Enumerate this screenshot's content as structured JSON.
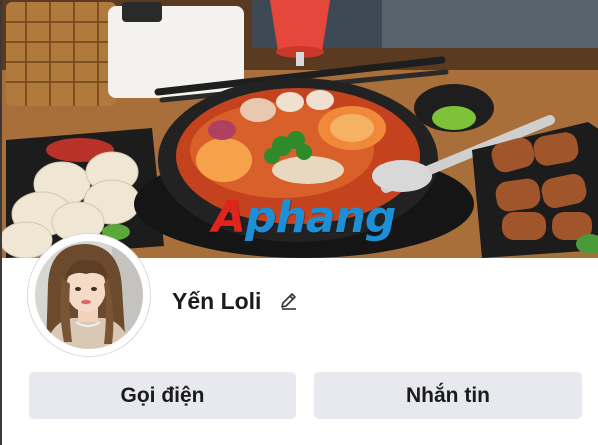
{
  "profile": {
    "display_name": "Yến Loli"
  },
  "actions": {
    "call_label": "Gọi điện",
    "message_label": "Nhắn tin"
  },
  "cover": {
    "watermark_first": "A",
    "watermark_rest": "phang"
  },
  "icons": {
    "edit": "pencil-icon"
  },
  "colors": {
    "button_bg": "#e7e9ee",
    "text": "#1b1b1b",
    "watermark_red": "#e0241b",
    "watermark_blue": "#1d8fd6"
  }
}
